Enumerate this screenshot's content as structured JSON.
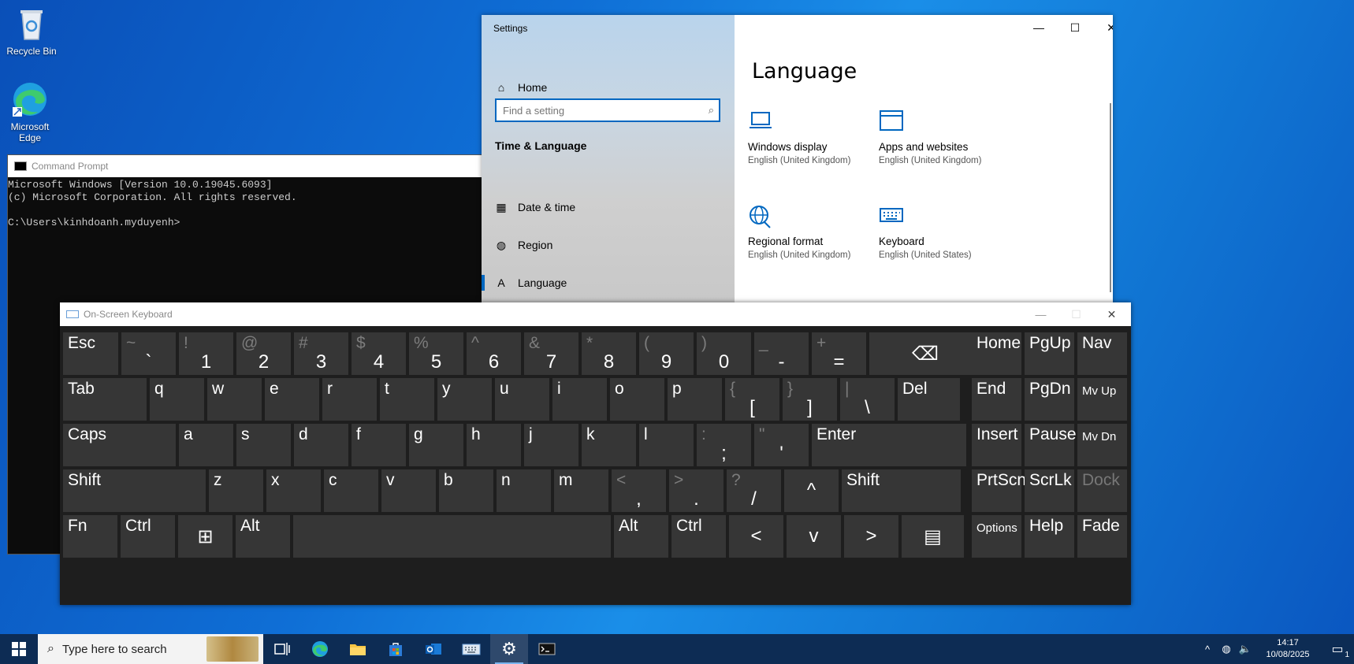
{
  "desktop": {
    "icons": [
      {
        "label": "Recycle Bin"
      },
      {
        "label": "Microsoft Edge"
      }
    ]
  },
  "cmd": {
    "title": "Command Prompt",
    "lines": [
      "Microsoft Windows [Version 10.0.19045.6093]",
      "(c) Microsoft Corporation. All rights reserved.",
      "",
      "C:\\Users\\kinhdoanh.myduyenh>"
    ]
  },
  "settings": {
    "window_title": "Settings",
    "home_label": "Home",
    "search_placeholder": "Find a setting",
    "section_title": "Time & Language",
    "nav": [
      {
        "label": "Date & time",
        "icon": "calendar-clock-icon"
      },
      {
        "label": "Region",
        "icon": "globe-icon"
      },
      {
        "label": "Language",
        "icon": "language-icon",
        "active": true
      }
    ],
    "page_title": "Language",
    "tiles": [
      {
        "name": "Windows display",
        "sub": "English (United Kingdom)",
        "icon": "laptop-icon"
      },
      {
        "name": "Apps and websites",
        "sub": "English (United Kingdom)",
        "icon": "window-icon"
      },
      {
        "name": "Regional format",
        "sub": "English (United Kingdom)",
        "icon": "globe-format-icon"
      },
      {
        "name": "Keyboard",
        "sub": "English (United States)",
        "icon": "keyboard-icon"
      }
    ],
    "accent": "#0067c0"
  },
  "osk": {
    "title": "On-Screen Keyboard",
    "rows": [
      [
        {
          "main": "Esc"
        },
        {
          "top": "~",
          "low": "`"
        },
        {
          "top": "!",
          "low": "1"
        },
        {
          "top": "@",
          "low": "2"
        },
        {
          "top": "#",
          "low": "3"
        },
        {
          "top": "$",
          "low": "4"
        },
        {
          "top": "%",
          "low": "5"
        },
        {
          "top": "^",
          "low": "6"
        },
        {
          "top": "&",
          "low": "7"
        },
        {
          "top": "*",
          "low": "8"
        },
        {
          "top": "(",
          "low": "9"
        },
        {
          "top": ")",
          "low": "0"
        },
        {
          "top": "_",
          "low": "-"
        },
        {
          "top": "+",
          "low": "="
        },
        {
          "glyph": "⌫",
          "icon": "backspace-icon"
        },
        {
          "main": "Home"
        },
        {
          "main": "PgUp"
        },
        {
          "main": "Nav"
        }
      ],
      [
        {
          "main": "Tab"
        },
        {
          "main": "q"
        },
        {
          "main": "w"
        },
        {
          "main": "e"
        },
        {
          "main": "r"
        },
        {
          "main": "t"
        },
        {
          "main": "y"
        },
        {
          "main": "u"
        },
        {
          "main": "i"
        },
        {
          "main": "o"
        },
        {
          "main": "p"
        },
        {
          "top": "{",
          "low": "["
        },
        {
          "top": "}",
          "low": "]"
        },
        {
          "top": "|",
          "low": "\\"
        },
        {
          "main": "Del"
        },
        {
          "main": "End"
        },
        {
          "main": "PgDn"
        },
        {
          "main": "Mv Up",
          "small": true
        }
      ],
      [
        {
          "main": "Caps"
        },
        {
          "main": "a"
        },
        {
          "main": "s"
        },
        {
          "main": "d"
        },
        {
          "main": "f"
        },
        {
          "main": "g"
        },
        {
          "main": "h"
        },
        {
          "main": "j"
        },
        {
          "main": "k"
        },
        {
          "main": "l"
        },
        {
          "top": ":",
          "low": ";"
        },
        {
          "top": "\"",
          "low": "'"
        },
        {
          "main": "Enter"
        },
        {
          "main": "Insert"
        },
        {
          "main": "Pause"
        },
        {
          "main": "Mv Dn",
          "small": true
        }
      ],
      [
        {
          "main": "Shift"
        },
        {
          "main": "z"
        },
        {
          "main": "x"
        },
        {
          "main": "c"
        },
        {
          "main": "v"
        },
        {
          "main": "b"
        },
        {
          "main": "n"
        },
        {
          "main": "m"
        },
        {
          "top": "<",
          "low": ","
        },
        {
          "top": ">",
          "low": "."
        },
        {
          "top": "?",
          "low": "/"
        },
        {
          "glyph": "^",
          "icon": "arrow-up-icon"
        },
        {
          "main": "Shift"
        },
        {
          "main": "PrtScn"
        },
        {
          "main": "ScrLk"
        },
        {
          "main": "Dock",
          "disabled": true
        }
      ],
      [
        {
          "main": "Fn"
        },
        {
          "main": "Ctrl"
        },
        {
          "glyph": "⊞",
          "icon": "windows-logo-icon"
        },
        {
          "main": "Alt"
        },
        {
          "main": ""
        },
        {
          "main": "Alt"
        },
        {
          "main": "Ctrl"
        },
        {
          "glyph": "<",
          "icon": "arrow-left-icon"
        },
        {
          "glyph": "v",
          "icon": "arrow-down-icon"
        },
        {
          "glyph": ">",
          "icon": "arrow-right-icon"
        },
        {
          "glyph": "▤",
          "icon": "context-menu-icon"
        },
        {
          "main": "Options",
          "small": true
        },
        {
          "main": "Help"
        },
        {
          "main": "Fade"
        }
      ]
    ]
  },
  "taskbar": {
    "search_placeholder": "Type here to search",
    "time": "14:17",
    "date": "10/08/2025",
    "notification_count": "1"
  }
}
